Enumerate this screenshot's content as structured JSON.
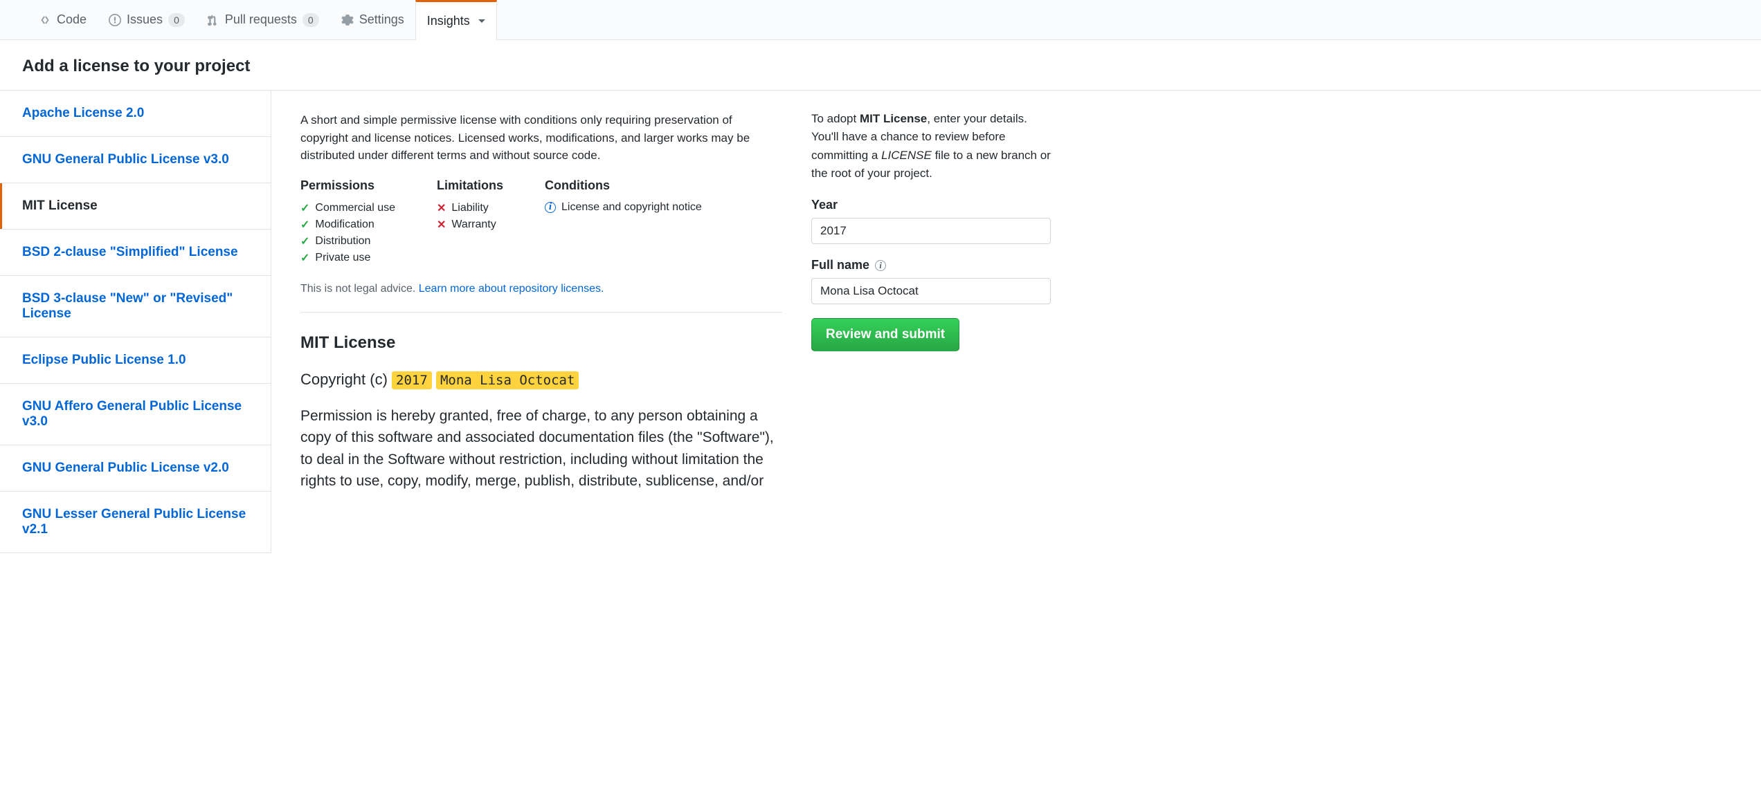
{
  "nav": {
    "code": "Code",
    "issues": "Issues",
    "issues_count": "0",
    "pulls": "Pull requests",
    "pulls_count": "0",
    "settings": "Settings",
    "insights": "Insights"
  },
  "heading": "Add a license to your project",
  "licenses": [
    "Apache License 2.0",
    "GNU General Public License v3.0",
    "MIT License",
    "BSD 2-clause \"Simplified\" License",
    "BSD 3-clause \"New\" or \"Revised\" License",
    "Eclipse Public License 1.0",
    "GNU Affero General Public License v3.0",
    "GNU General Public License v2.0",
    "GNU Lesser General Public License v2.1"
  ],
  "selected_index": 2,
  "detail": {
    "description": "A short and simple permissive license with conditions only requiring preservation of copyright and license notices. Licensed works, modifications, and larger works may be distributed under different terms and without source code.",
    "permissions_h": "Permissions",
    "limitations_h": "Limitations",
    "conditions_h": "Conditions",
    "permissions": [
      "Commercial use",
      "Modification",
      "Distribution",
      "Private use"
    ],
    "limitations": [
      "Liability",
      "Warranty"
    ],
    "conditions": [
      "License and copyright notice"
    ],
    "advice_text": "This is not legal advice. ",
    "advice_link": "Learn more about repository licenses.",
    "license_title": "MIT License",
    "copyright_prefix": "Copyright (c) ",
    "hl_year": "2017",
    "hl_name": "Mona Lisa Octocat",
    "body": "Permission is hereby granted, free of charge, to any person obtaining a copy of this software and associated documentation files (the \"Software\"), to deal in the Software without restriction, including without limitation the rights to use, copy, modify, merge, publish, distribute, sublicense, and/or"
  },
  "form": {
    "adopt_pre": "To adopt ",
    "adopt_license": "MIT License",
    "adopt_mid": ", enter your details. You'll have a chance to review before committing a ",
    "adopt_file": "LICENSE",
    "adopt_post": " file to a new branch or the root of your project.",
    "year_label": "Year",
    "year_value": "2017",
    "name_label": "Full name",
    "name_value": "Mona Lisa Octocat",
    "submit": "Review and submit"
  }
}
